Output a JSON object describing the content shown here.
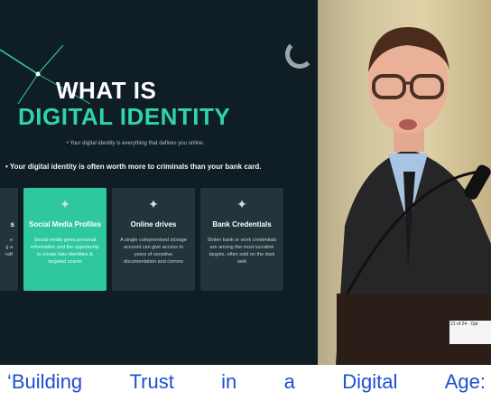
{
  "slide": {
    "title_line1": "WHAT IS",
    "title_line2": "DIGITAL IDENTITY",
    "subtitle": "• Your digital identity is everything that defines you online.",
    "bold_line": "• Your digital identity is often worth more to criminals than your bank card.",
    "cards": [
      {
        "title": "s",
        "text": "e\ng a\nraft"
      },
      {
        "title": "Social Media Profiles",
        "text": "Social media gives personal information and the opportunity to create fake identities & targeted scams"
      },
      {
        "title": "Online drives",
        "text": "A single compromised storage account can give access to years of sensitive documentation and comms"
      },
      {
        "title": "Bank Credentials",
        "text": "Stolen bank or work credentials are among the most lucrative targets, often sold on the dark web"
      }
    ],
    "icon": "shield-badge-icon",
    "colors": {
      "accent": "#2fd4a9",
      "background": "#0f1d24"
    }
  },
  "podium_label": "21 of 24 · Opt",
  "caption": {
    "words": [
      "‘Building",
      "Trust",
      "in",
      "a",
      "Digital",
      "Age:"
    ]
  }
}
